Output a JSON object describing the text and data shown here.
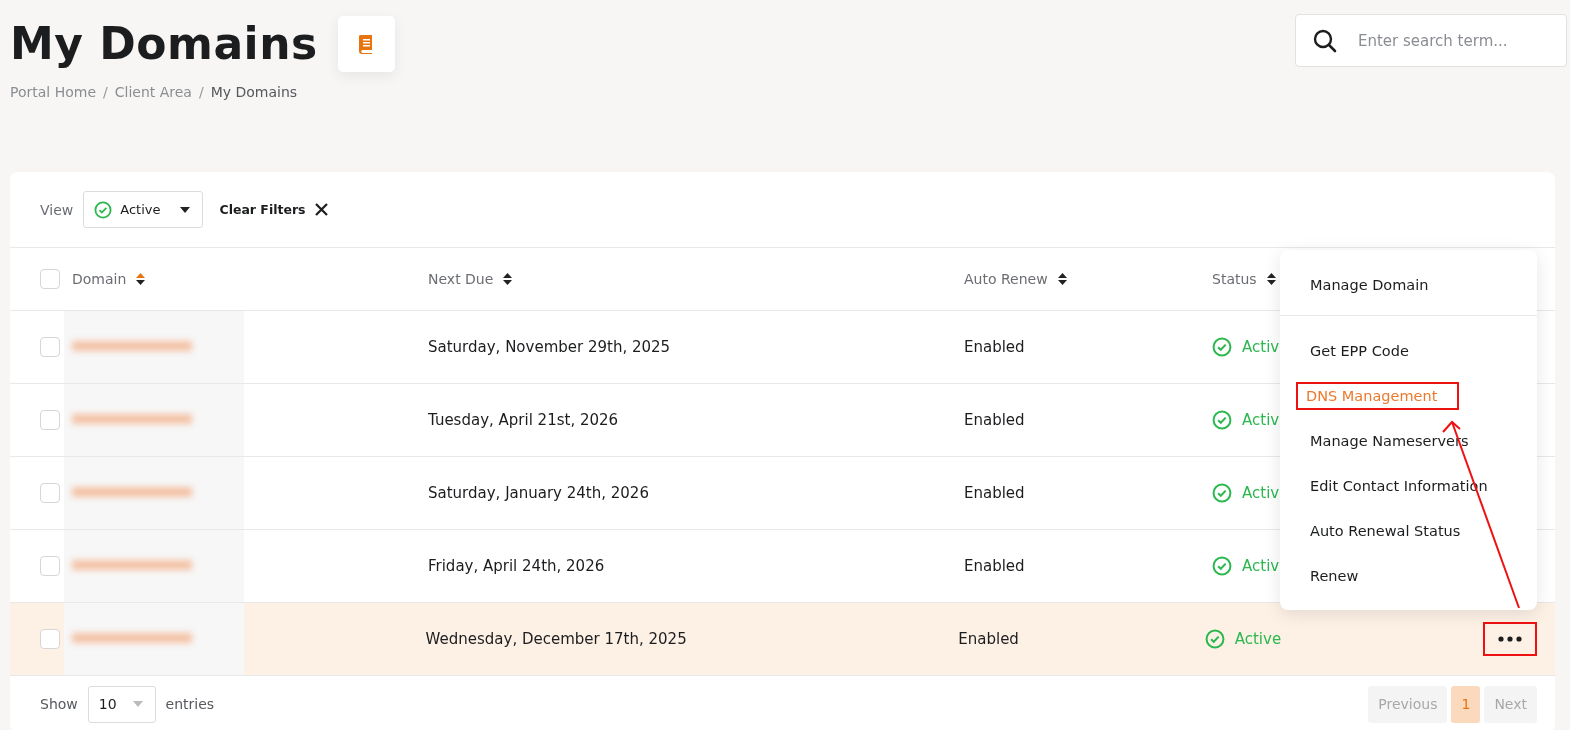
{
  "page": {
    "title": "My Domains",
    "breadcrumb": [
      {
        "label": "Portal Home",
        "current": false
      },
      {
        "separator": "/",
        "label": "Client Area",
        "current": false
      },
      {
        "separator": "/",
        "label": "My Domains",
        "current": true
      }
    ]
  },
  "search": {
    "placeholder": "Enter search term..."
  },
  "filters": {
    "view_label": "View",
    "view_value": "Active",
    "clear_label": "Clear Filters"
  },
  "table": {
    "select_all_checked": false,
    "columns": [
      {
        "label": "Domain",
        "sorted": true
      },
      {
        "label": "Next Due",
        "sorted": false
      },
      {
        "label": "Auto Renew",
        "sorted": false
      },
      {
        "label": "Status",
        "sorted": false
      }
    ],
    "rows": [
      {
        "checked": false,
        "selected": false,
        "next_due": "Saturday, November 29th, 2025",
        "auto_renew": "Enabled",
        "status": "Activ"
      },
      {
        "checked": false,
        "selected": false,
        "next_due": "Tuesday, April 21st, 2026",
        "auto_renew": "Enabled",
        "status": "Activ"
      },
      {
        "checked": false,
        "selected": false,
        "next_due": "Saturday, January 24th, 2026",
        "auto_renew": "Enabled",
        "status": "Activ"
      },
      {
        "checked": false,
        "selected": false,
        "next_due": "Friday, April 24th, 2026",
        "auto_renew": "Enabled",
        "status": "Activ"
      },
      {
        "checked": false,
        "selected": true,
        "next_due": "Wednesday, December 17th, 2025",
        "auto_renew": "Enabled",
        "status": "Active",
        "actions_highlighted": true
      }
    ]
  },
  "menu": {
    "items": [
      {
        "label": "Manage Domain",
        "highlighted": false,
        "divider_after": true
      },
      {
        "label": "Get EPP Code",
        "highlighted": false,
        "divider_after": false
      },
      {
        "label": "DNS Management",
        "highlighted": true,
        "divider_after": false
      },
      {
        "label": "Manage Nameservers",
        "highlighted": false,
        "divider_after": false
      },
      {
        "label": "Edit Contact Information",
        "highlighted": false,
        "divider_after": false
      },
      {
        "label": "Auto Renewal Status",
        "highlighted": false,
        "divider_after": false
      },
      {
        "label": "Renew",
        "highlighted": false,
        "divider_after": false
      }
    ]
  },
  "annotation_arrow": true,
  "footer": {
    "show_label": "Show",
    "page_size": "10",
    "entries_label": "entries"
  },
  "pagination": [
    {
      "label": "Previous",
      "selected": false,
      "disabled": true
    },
    {
      "label": "1",
      "selected": true,
      "disabled": false
    },
    {
      "label": "Next",
      "selected": false,
      "disabled": true
    }
  ]
}
